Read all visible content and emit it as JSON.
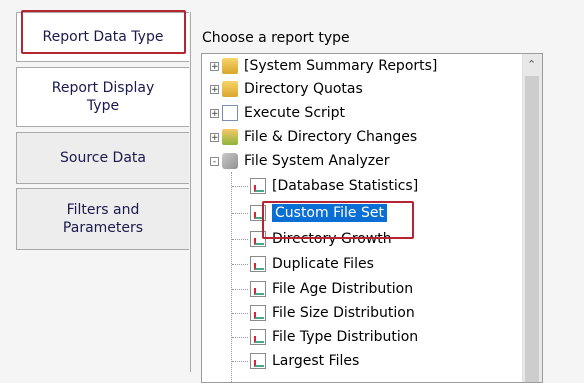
{
  "tabs": [
    {
      "label": "Report Data Type"
    },
    {
      "label": "Report Display Type"
    },
    {
      "label": "Source Data"
    },
    {
      "label": "Filters and Parameters"
    }
  ],
  "heading": "Choose a report type",
  "tree": {
    "items": [
      {
        "label": "[System Summary Reports]",
        "expander": "+",
        "icon": "folder-icon"
      },
      {
        "label": "Directory Quotas",
        "expander": "+",
        "icon": "folder-icon"
      },
      {
        "label": "Execute Script",
        "expander": "+",
        "icon": "script-icon"
      },
      {
        "label": "File & Directory Changes",
        "expander": "+",
        "icon": "changes-icon"
      },
      {
        "label": "File System Analyzer",
        "expander": "-",
        "icon": "analyzer-icon"
      },
      {
        "label": "[Database Statistics]",
        "icon": "report-icon"
      },
      {
        "label": "Custom File Set",
        "icon": "report-icon",
        "selected": true
      },
      {
        "label": "Directory Growth",
        "icon": "report-icon"
      },
      {
        "label": "Duplicate Files",
        "icon": "report-icon"
      },
      {
        "label": "File Age Distribution",
        "icon": "report-icon"
      },
      {
        "label": "File Size Distribution",
        "icon": "report-icon"
      },
      {
        "label": "File Type Distribution",
        "icon": "report-icon"
      },
      {
        "label": "Largest Files",
        "icon": "report-icon"
      }
    ]
  },
  "colors": {
    "selection": "#0a6fd4",
    "highlight_box": "#b52532"
  }
}
